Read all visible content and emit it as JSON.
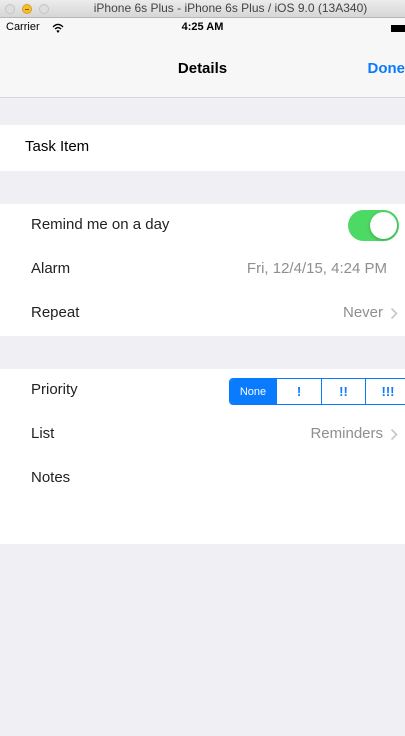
{
  "simulator": {
    "title": "iPhone 6s Plus - iPhone 6s Plus / iOS 9.0 (13A340)"
  },
  "status_bar": {
    "carrier": "Carrier",
    "time": "4:25 AM"
  },
  "nav": {
    "title": "Details",
    "done_label": "Done"
  },
  "task": {
    "title": "Task Item"
  },
  "reminder": {
    "remind_label": "Remind me on a day",
    "remind_enabled": true,
    "alarm_label": "Alarm",
    "alarm_value": "Fri, 12/4/15, 4:24 PM",
    "repeat_label": "Repeat",
    "repeat_value": "Never"
  },
  "details": {
    "priority_label": "Priority",
    "priority_options": [
      "None",
      "!",
      "!!",
      "!!!"
    ],
    "priority_selected": "None",
    "list_label": "List",
    "list_value": "Reminders",
    "notes_label": "Notes"
  },
  "colors": {
    "accent": "#0a7aff",
    "toggle_on": "#4cd964",
    "background": "#efeff4"
  }
}
